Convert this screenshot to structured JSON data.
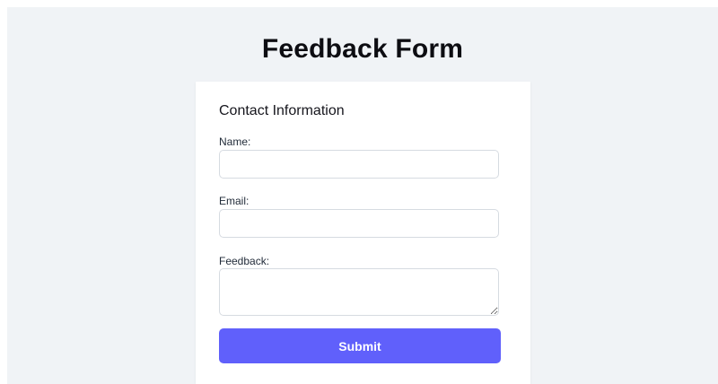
{
  "page": {
    "title": "Feedback Form"
  },
  "form": {
    "section_title": "Contact Information",
    "fields": {
      "name": {
        "label": "Name:",
        "value": "",
        "placeholder": ""
      },
      "email": {
        "label": "Email:",
        "value": "",
        "placeholder": ""
      },
      "feedback": {
        "label": "Feedback:",
        "value": "",
        "placeholder": ""
      }
    },
    "submit_label": "Submit"
  },
  "colors": {
    "background": "#f0f3f6",
    "card": "#ffffff",
    "accent": "#6060fb",
    "border": "#d6dbe1"
  }
}
